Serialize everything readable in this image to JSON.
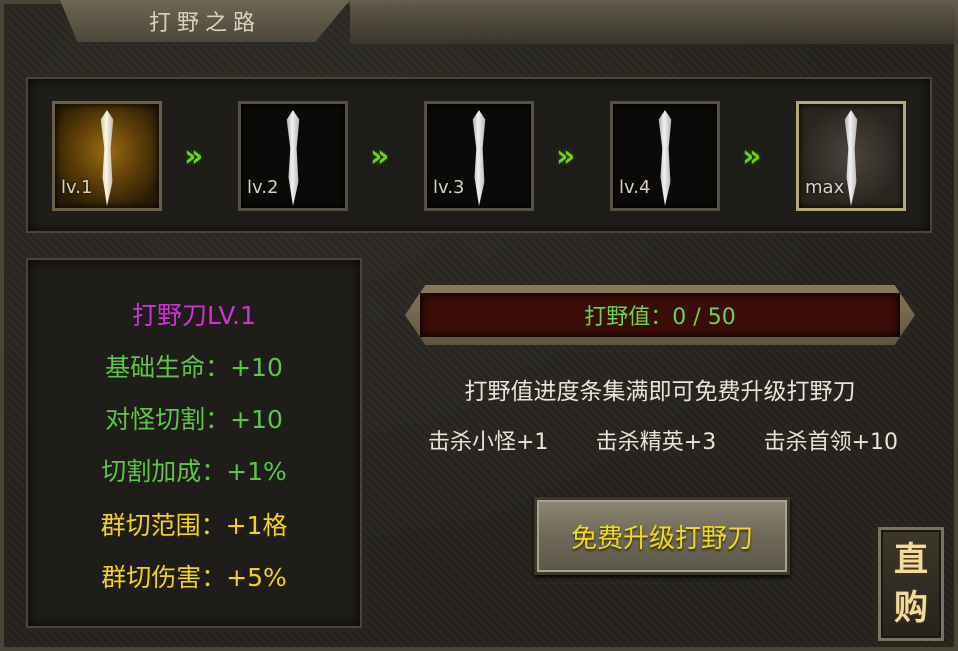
{
  "title": "打野之路",
  "levels": [
    {
      "label": "lv.1",
      "state": "current"
    },
    {
      "label": "lv.2",
      "state": "locked"
    },
    {
      "label": "lv.3",
      "state": "locked"
    },
    {
      "label": "lv.4",
      "state": "locked"
    },
    {
      "label": "max",
      "state": "final"
    }
  ],
  "stats": {
    "weapon_name": "打野刀LV.1",
    "lines": [
      {
        "text": "基础生命：+10",
        "color": "green"
      },
      {
        "text": "对怪切割：+10",
        "color": "green"
      },
      {
        "text": "切割加成：+1%",
        "color": "green"
      },
      {
        "text": "群切范围：+1格",
        "color": "yellow"
      },
      {
        "text": "群切伤害：+5%",
        "color": "yellow"
      }
    ]
  },
  "progress": {
    "label": "打野值：0 / 50",
    "current": 0,
    "max": 50
  },
  "description": "打野值进度条集满即可免费升级打野刀",
  "kill_rules": [
    "击杀小怪+1",
    "击杀精英+3",
    "击杀首领+10"
  ],
  "upgrade_button": "免费升级打野刀",
  "direct_buy": [
    "直",
    "购"
  ],
  "colors": {
    "weapon_name": "#d030d8",
    "green_stat": "#5fc548",
    "yellow_stat": "#f2d21b",
    "progress_text": "#6fd24a",
    "button_text": "#f4d81c"
  }
}
